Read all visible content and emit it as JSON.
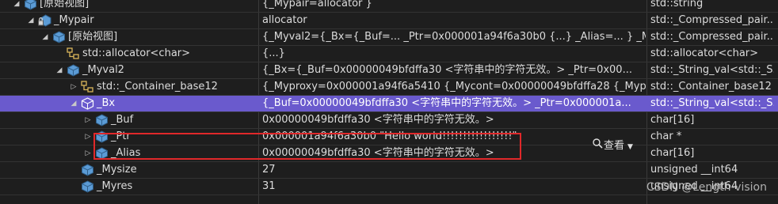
{
  "rows": [
    {
      "name": "[原始视图]",
      "value": "{_Mypair=allocator }",
      "type": "std::string",
      "arrow": "down",
      "icon": "cube",
      "selected": false
    },
    {
      "name": "_Mypair",
      "value": "allocator",
      "type": "std::_Compressed_pair...",
      "arrow": "down",
      "icon": "locked-cube",
      "selected": false
    },
    {
      "name": "[原始视图]",
      "value": "{_Myval2={_Bx={_Buf=... _Ptr=0x000001a94f6a30b0 {...} _Alias=... } _Mysiz...",
      "type": "std::_Compressed_pair...",
      "arrow": "down",
      "icon": "cube",
      "selected": false
    },
    {
      "name": "std::allocator<char>",
      "value": "{...}",
      "type": "std::allocator<char>",
      "arrow": "none",
      "icon": "class",
      "selected": false
    },
    {
      "name": "_Myval2",
      "value": "{_Bx={_Buf=0x00000049bfdffa30 <字符串中的字符无效。> _Ptr=0x00...",
      "type": "std::_String_val<std::_S...",
      "arrow": "down",
      "icon": "cube",
      "selected": false
    },
    {
      "name": "std::_Container_base12",
      "value": "{_Myproxy=0x000001a94f6a5410 {_Mycont=0x00000049bfdffa28 {_Mypr...",
      "type": "std::_Container_base12",
      "arrow": "right",
      "icon": "class",
      "selected": false
    },
    {
      "name": "_Bx",
      "value": "{_Buf=0x00000049bfdffa30 <字符串中的字符无效。> _Ptr=0x000001a...",
      "type": "std::_String_val<std::_S...",
      "arrow": "down",
      "icon": "union",
      "selected": true
    },
    {
      "name": "_Buf",
      "value": "0x00000049bfdffa30 <字符串中的字符无效。>",
      "type": "char[16]",
      "arrow": "right",
      "icon": "cube",
      "selected": false
    },
    {
      "name": "_Ptr",
      "value": "0x000001a94f6a30b0 \"Hello world!!!!!!!!!!!!!!!!!\"",
      "type": "char *",
      "arrow": "right",
      "icon": "cube",
      "selected": false
    },
    {
      "name": "_Alias",
      "value": "0x00000049bfdffa30 <字符串中的字符无效。>",
      "type": "char[16]",
      "arrow": "right",
      "icon": "cube",
      "selected": false
    },
    {
      "name": "_Mysize",
      "value": "27",
      "type": "unsigned __int64",
      "arrow": "none",
      "icon": "cube",
      "selected": false
    },
    {
      "name": "_Myres",
      "value": "31",
      "type": "unsigned __int64",
      "arrow": "none",
      "icon": "cube",
      "selected": false
    }
  ],
  "view_button": {
    "label": "查看",
    "icon": "magnifier-icon"
  },
  "watermark": "CSDN @Length-vision",
  "colors": {
    "selected": "#6a5acd",
    "highlight": "#e0282a",
    "icon": "#5b9bd5"
  }
}
